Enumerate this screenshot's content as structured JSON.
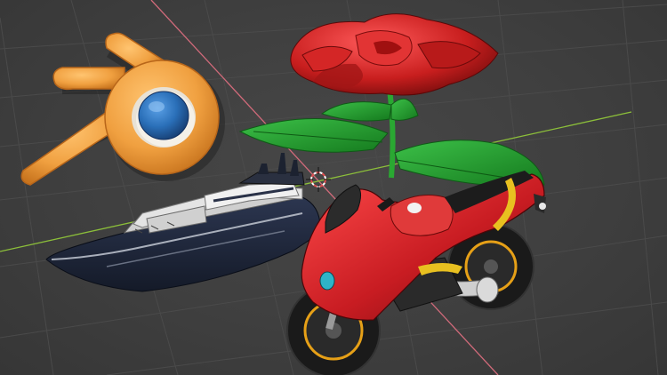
{
  "viewport": {
    "background_color": "#3f3f3f",
    "grid_color": "#4c4c4c",
    "x_axis_color": "#d06a7a",
    "y_axis_color": "#8cbf3a"
  },
  "logo": {
    "name": "blender-logo",
    "colors": {
      "orange": "#f0a040",
      "orange_dark": "#c8741e",
      "blue": "#2a6fb8",
      "blue_dark": "#173e72"
    }
  },
  "scene_objects": [
    {
      "name": "rose",
      "colors": {
        "petals": "#c81e1e",
        "petals_dark": "#7a0c0c",
        "leaves": "#1e9628",
        "stem": "#2aa832"
      }
    },
    {
      "name": "yacht",
      "colors": {
        "hull": "#1c2438",
        "deck": "#d8d8d8",
        "trim": "#9aa0aa"
      }
    },
    {
      "name": "motorcycle",
      "colors": {
        "body": "#c81c22",
        "accent": "#e8c020",
        "tire": "#1a1a1a",
        "rim": "#e6a017"
      }
    }
  ],
  "widgets": {
    "origin": "3d-cursor-icon"
  }
}
